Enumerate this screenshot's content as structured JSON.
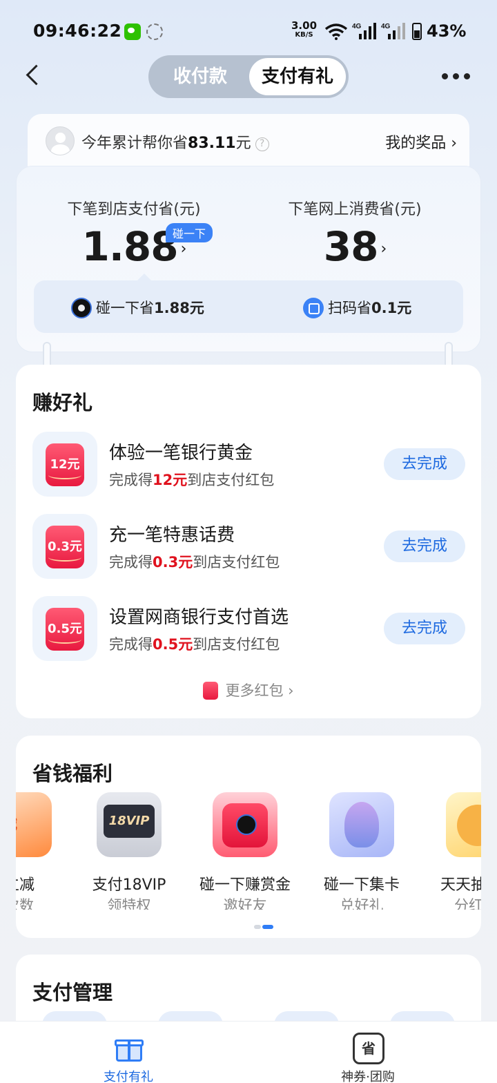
{
  "status_bar": {
    "time": "09:46:22",
    "net_speed": "3.00",
    "net_unit": "KB/S",
    "signal_1": "4G",
    "signal_2": "4G",
    "battery": "43%"
  },
  "header": {
    "tabs": [
      {
        "label": "收付款",
        "active": false
      },
      {
        "label": "支付有礼",
        "active": true
      }
    ]
  },
  "savings": {
    "prefix": "今年累计帮你省",
    "amount": "83.11",
    "unit": "元",
    "prizes_link": "我的奖品 ›"
  },
  "next_savings": {
    "store": {
      "label": "下笔到店支付省(元)",
      "value": "1.88",
      "badge": "碰一下"
    },
    "online": {
      "label": "下笔网上消费省(元)",
      "value": "38"
    },
    "strip": [
      {
        "prefix": "碰一下省",
        "value": "1.88元",
        "icon": "nfc-pay-icon"
      },
      {
        "prefix": "扫码省",
        "value": "0.1元",
        "icon": "scan-icon"
      }
    ]
  },
  "earn_gifts": {
    "title": "赚好礼",
    "tasks": [
      {
        "icon_text": "12元",
        "title": "体验一笔银行黄金",
        "sub_prefix": "完成得",
        "amount": "12元",
        "sub_suffix": "到店支付红包",
        "button": "去完成"
      },
      {
        "icon_text": "0.3元",
        "title": "充一笔特惠话费",
        "sub_prefix": "完成得",
        "amount": "0.3元",
        "sub_suffix": "到店支付红包",
        "button": "去完成"
      },
      {
        "icon_text": "0.5元",
        "title": "设置网商银行支付首选",
        "sub_prefix": "完成得",
        "amount": "0.5元",
        "sub_suffix": "到店支付红包",
        "button": "去完成"
      }
    ],
    "more": "更多红包 ›"
  },
  "benefits": {
    "title": "省钱福利",
    "items": [
      {
        "tile_text": "立减",
        "name": "立减",
        "sub": "次数"
      },
      {
        "tile_text": "18VIP",
        "name": "支付18VIP",
        "sub": "领特权"
      },
      {
        "tile_text": "",
        "name": "碰一下赚赏金",
        "sub": "邀好友"
      },
      {
        "tile_text": "",
        "name": "碰一下集卡",
        "sub": "兑好礼"
      },
      {
        "tile_text": "",
        "name": "天天抽",
        "sub": "分红"
      }
    ]
  },
  "management": {
    "title": "支付管理"
  },
  "tabbar": {
    "items": [
      {
        "label": "支付有礼",
        "icon": "gift-icon",
        "active": true
      },
      {
        "label": "神券·团购",
        "icon": "coupon-icon",
        "icon_text": "省",
        "active": false
      }
    ]
  },
  "colors": {
    "accent": "#1e6ae0",
    "red_amount": "#e0121e",
    "badge_blue": "#3b82f6"
  }
}
